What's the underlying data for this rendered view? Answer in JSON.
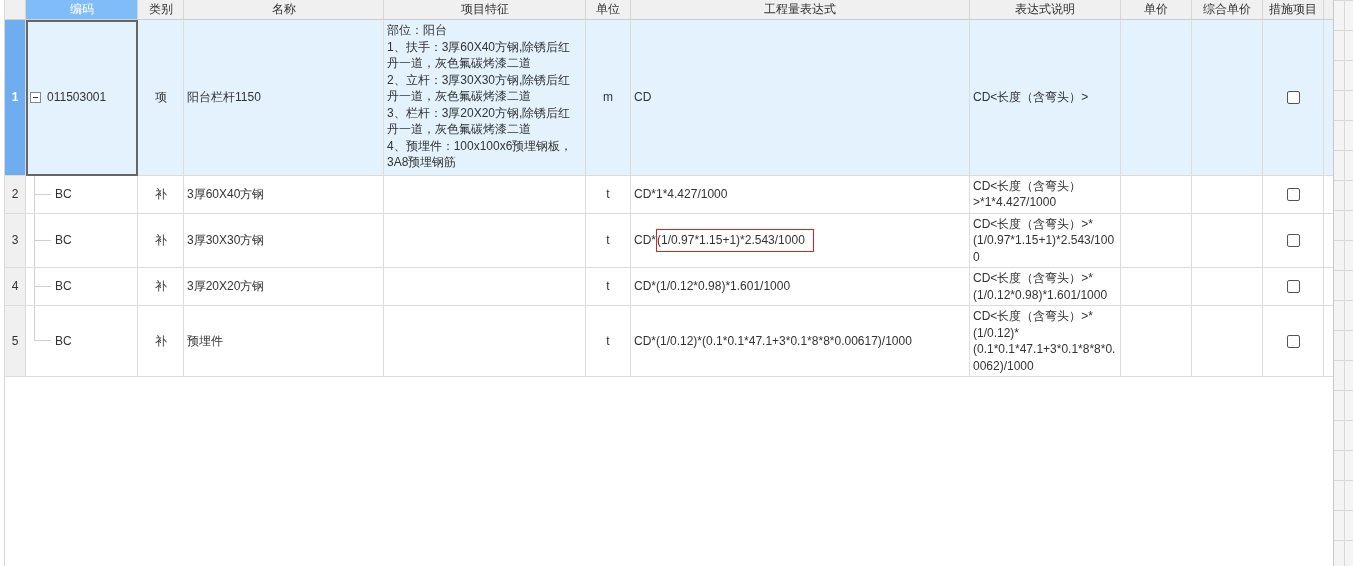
{
  "table": {
    "columns": [
      {
        "label": "编码",
        "selected": true
      },
      {
        "label": "类别",
        "selected": false
      },
      {
        "label": "名称",
        "selected": false
      },
      {
        "label": "项目特征",
        "selected": false
      },
      {
        "label": "单位",
        "selected": false
      },
      {
        "label": "工程量表达式",
        "selected": false
      },
      {
        "label": "表达式说明",
        "selected": false
      },
      {
        "label": "单价",
        "selected": false
      },
      {
        "label": "综合单价",
        "selected": false
      },
      {
        "label": "措施项目",
        "selected": false
      }
    ],
    "rows": [
      {
        "number": "1",
        "code": "011503001",
        "type": "项",
        "name": "阳台栏杆1150",
        "features": [
          "部位：阳台",
          "1、扶手：3厚60X40方钢,除锈后红丹一道，灰色氟碳烤漆二道",
          "2、立杆：3厚30X30方钢,除锈后红丹一道，灰色氟碳烤漆二道",
          "3、栏杆：3厚20X20方钢,除锈后红丹一道，灰色氟碳烤漆二道",
          "4、预埋件：100x100x6预埋钢板，3A8预埋钢筋"
        ],
        "unit": "m",
        "expression": [
          {
            "text": "CD",
            "marked": false
          }
        ],
        "description": "CD<长度（含弯头）>",
        "measure": false,
        "selected": true,
        "expanded": true,
        "children": [
          {
            "number": "2",
            "code": "BC",
            "type": "补",
            "name": "3厚60X40方钢",
            "unit": "t",
            "expression": [
              {
                "text": "CD*1*4.427/1000",
                "marked": false
              }
            ],
            "description": "CD<长度（含弯头）>*1*4.427/1000",
            "measure": false,
            "selected": false
          },
          {
            "number": "3",
            "code": "BC",
            "type": "补",
            "name": "3厚30X30方钢",
            "unit": "t",
            "expression": [
              {
                "text": "CD*",
                "marked": false
              },
              {
                "text": "(1/0.97*1.15+1)*2.543/1000",
                "marked": true
              }
            ],
            "description": "CD<长度（含弯头）>*(1/0.97*1.15+1)*2.543/1000",
            "measure": false,
            "selected": false
          },
          {
            "number": "4",
            "code": "BC",
            "type": "补",
            "name": "3厚20X20方钢",
            "unit": "t",
            "expression": [
              {
                "text": "CD*(1/0.12*0.98)*1.601/1000",
                "marked": false
              }
            ],
            "description": "CD<长度（含弯头）>*(1/0.12*0.98)*1.601/1000",
            "measure": false,
            "selected": false
          },
          {
            "number": "5",
            "code": "BC",
            "type": "补",
            "name": "预埋件",
            "unit": "t",
            "expression": [
              {
                "text": "CD*(1/0.12)*(0.1*0.1*47.1+3*0.1*8*8*0.00617)/1000",
                "marked": false
              }
            ],
            "description": "CD<长度（含弯头）>*(1/0.12)*(0.1*0.1*47.1+3*0.1*8*8*0.0062)/1000",
            "measure": false,
            "selected": false
          }
        ]
      }
    ]
  }
}
